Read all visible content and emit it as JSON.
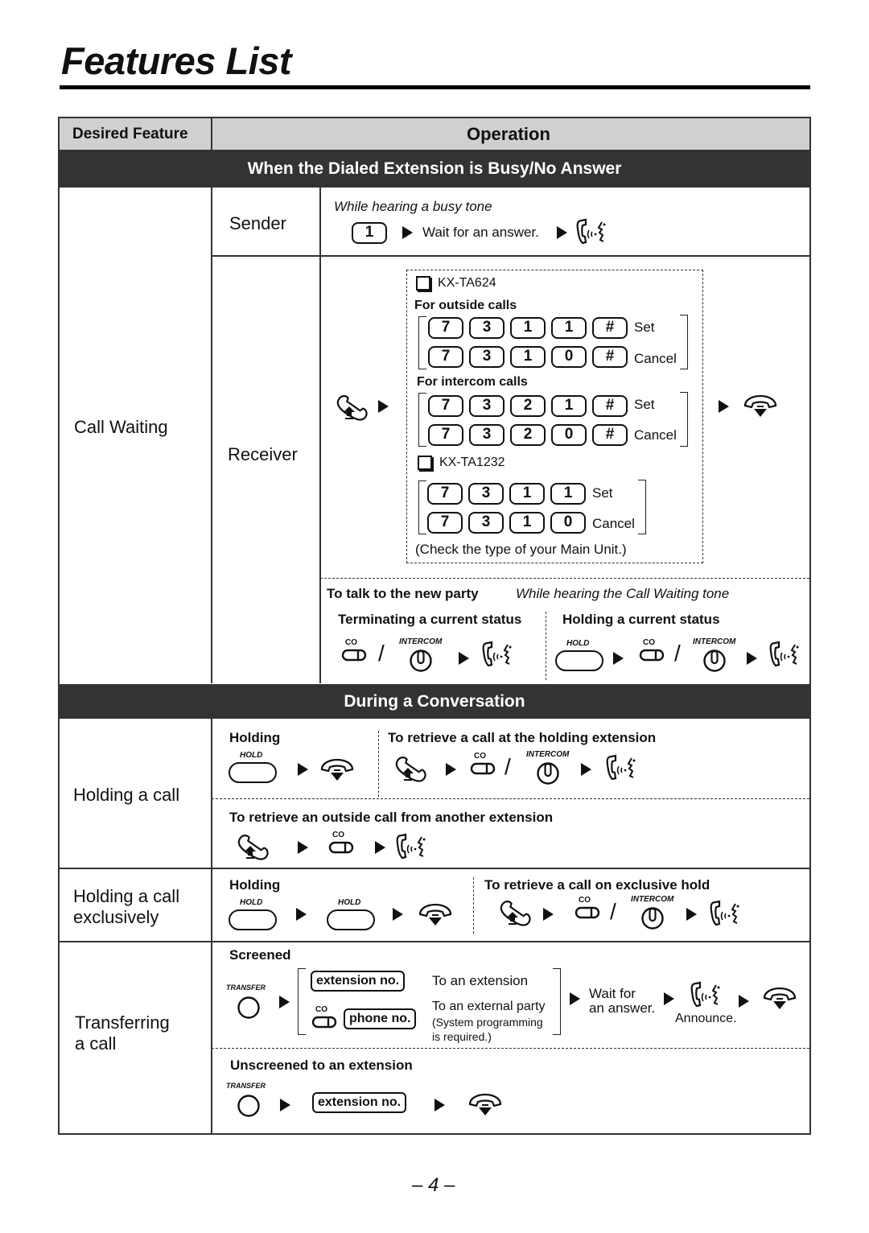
{
  "page": {
    "title": "Features List",
    "page_number": "– 4 –"
  },
  "table": {
    "col_headers": {
      "feature": "Desired Feature",
      "operation": "Operation"
    },
    "sections": {
      "busy": "When the Dialed Extension is Busy/No Answer",
      "conversation": "During a Conversation"
    }
  },
  "call_waiting": {
    "feature": "Call Waiting",
    "sender": {
      "role": "Sender",
      "condition": "While hearing a busy tone",
      "key": "1",
      "step": "Wait for an answer."
    },
    "receiver": {
      "role": "Receiver",
      "model_a": "KX-TA624",
      "outside_label": "For outside calls",
      "outside_set_keys": [
        "7",
        "3",
        "1",
        "1",
        "#"
      ],
      "outside_cancel_keys": [
        "7",
        "3",
        "1",
        "0",
        "#"
      ],
      "intercom_label": "For intercom calls",
      "intercom_set_keys": [
        "7",
        "3",
        "2",
        "1",
        "#"
      ],
      "intercom_cancel_keys": [
        "7",
        "3",
        "2",
        "0",
        "#"
      ],
      "model_b": "KX-TA1232",
      "b_set_keys": [
        "7",
        "3",
        "1",
        "1"
      ],
      "b_cancel_keys": [
        "7",
        "3",
        "1",
        "0"
      ],
      "set_label": "Set",
      "cancel_label": "Cancel",
      "note": "(Check the type of your Main Unit.)",
      "talk_label": "To talk to the new party",
      "talk_condition": "While hearing the Call Waiting tone",
      "terminating_label": "Terminating a current status",
      "holding_label": "Holding a current status"
    }
  },
  "holding_call": {
    "feature": "Holding a call",
    "holding_label": "Holding",
    "retrieve_label": "To retrieve a call at the holding extension",
    "retrieve_other_label": "To retrieve an outside call from another extension"
  },
  "holding_exclusive": {
    "feature_line1": "Holding a call",
    "feature_line2": "exclusively",
    "holding_label": "Holding",
    "retrieve_label": "To retrieve a call on exclusive hold"
  },
  "transfer": {
    "feature_line1": "Transferring",
    "feature_line2": "a call",
    "screened_label": "Screened",
    "ext_box": "extension no.",
    "phone_box": "phone no.",
    "to_extension": "To an extension",
    "to_external": "To an external party",
    "note_line1": "(System programming",
    "note_line2": "is required.)",
    "wait_line1": "Wait for",
    "wait_line2": "an answer.",
    "announce": "Announce.",
    "unscreened_label": "Unscreened to an extension"
  },
  "icons": {
    "hold": "HOLD",
    "co": "CO",
    "intercom": "INTERCOM",
    "transfer": "TRANSFER",
    "slash": "/"
  }
}
